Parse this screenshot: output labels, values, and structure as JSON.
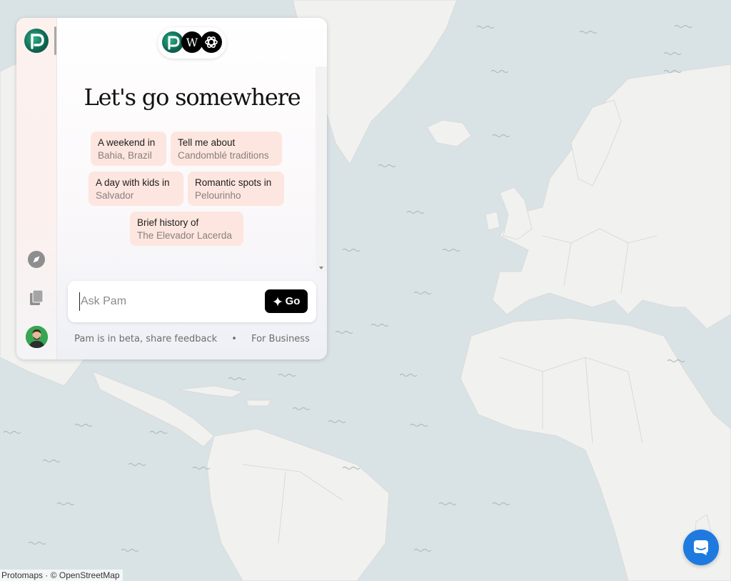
{
  "map": {
    "attribution": "Protomaps · © OpenStreetMap"
  },
  "sidebar": {
    "logo_icon": "pam-logo-icon",
    "items": [
      {
        "icon": "compass-icon"
      },
      {
        "icon": "collections-icon"
      }
    ],
    "avatar_icon": "user-avatar"
  },
  "sources": {
    "icons": [
      "pam-logo-icon",
      "wikipedia-icon",
      "openai-icon"
    ]
  },
  "main": {
    "heading": "Let's go somewhere",
    "suggestions": [
      {
        "line1": "A weekend in",
        "line2": "Bahia, Brazil"
      },
      {
        "line1": "Tell me about",
        "line2": "Candomblé traditions"
      },
      {
        "line1": "A day with kids in",
        "line2": "Salvador"
      },
      {
        "line1": "Romantic spots in",
        "line2": "Pelourinho"
      },
      {
        "line1": "Brief history of",
        "line2": "The Elevador Lacerda"
      }
    ]
  },
  "ask": {
    "placeholder": "Ask Pam",
    "value": "",
    "go_label": "Go"
  },
  "footer": {
    "beta_text": "Pam is in beta, share feedback",
    "separator": "•",
    "business_link": "For Business"
  },
  "colors": {
    "chip_bg": "#fde6df",
    "go_button": "#000000",
    "chat_button": "#1f7ae0"
  }
}
